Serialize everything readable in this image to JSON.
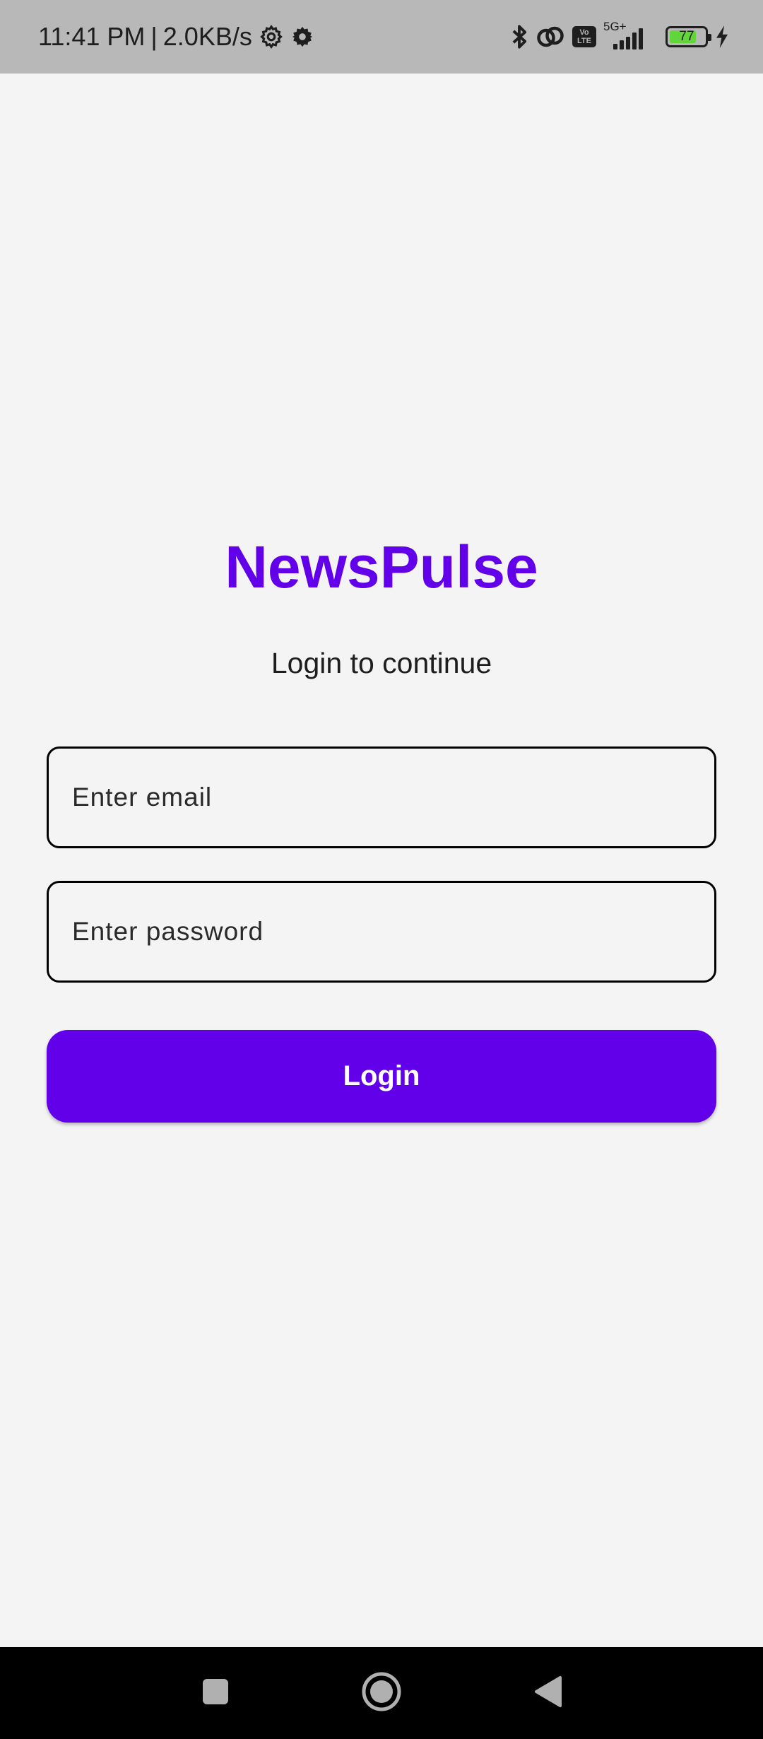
{
  "status_bar": {
    "time": "11:41 PM",
    "separator": "|",
    "net_speed": "2.0KB/s",
    "left_icons": [
      "settings-gear-outline-icon",
      "settings-gear-icon"
    ],
    "right_icons": [
      "bluetooth-icon",
      "hotspot-link-icon",
      "volte-icon",
      "signal-icon",
      "battery-icon",
      "charging-icon"
    ],
    "volte_top": "Vo",
    "volte_bottom": "LTE",
    "network_type": "5G+",
    "battery_level": "77",
    "battery_fraction": 0.77,
    "battery_color": "#62d53a"
  },
  "app": {
    "title": "NewsPulse",
    "subtitle": "Login to continue",
    "accent_color": "#6200ea"
  },
  "form": {
    "email_placeholder": "Enter email",
    "email_value": "",
    "password_placeholder": "Enter password",
    "password_value": "",
    "login_label": "Login"
  },
  "nav_bar": {
    "buttons": [
      "recent-apps-icon",
      "home-icon",
      "back-icon"
    ]
  }
}
